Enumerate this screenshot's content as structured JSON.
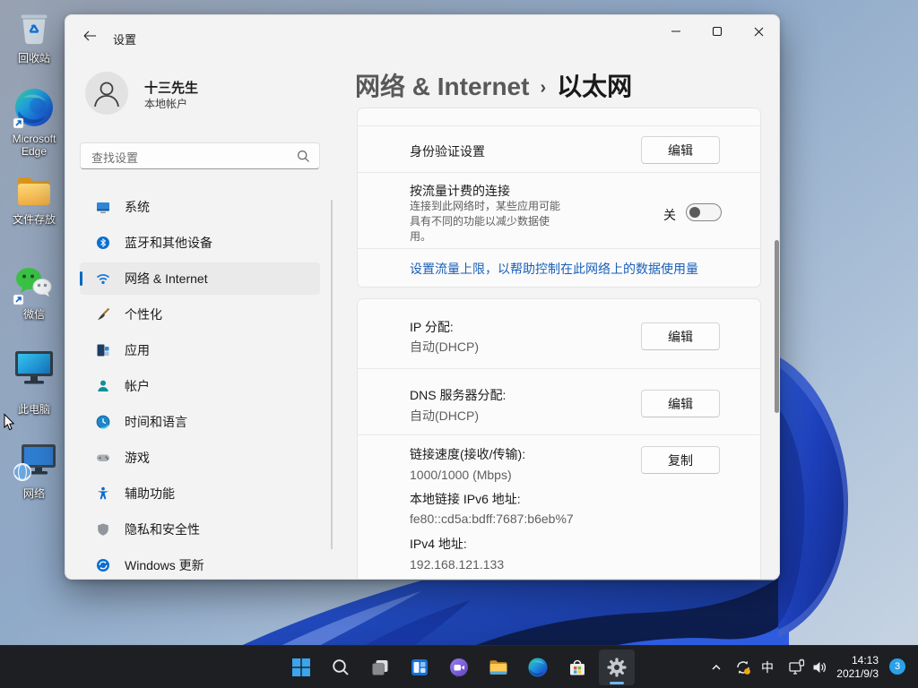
{
  "desktop": {
    "icons": [
      {
        "label": "回收站"
      },
      {
        "label": "Microsoft Edge"
      },
      {
        "label": "文件存放"
      },
      {
        "label": "微信"
      },
      {
        "label": "此电脑"
      },
      {
        "label": "网络"
      }
    ]
  },
  "window": {
    "title": "设置",
    "user": {
      "name": "十三先生",
      "type": "本地帐户"
    },
    "search_placeholder": "查找设置",
    "nav": [
      {
        "label": "系统"
      },
      {
        "label": "蓝牙和其他设备"
      },
      {
        "label": "网络 & Internet"
      },
      {
        "label": "个性化"
      },
      {
        "label": "应用"
      },
      {
        "label": "帐户"
      },
      {
        "label": "时间和语言"
      },
      {
        "label": "游戏"
      },
      {
        "label": "辅助功能"
      },
      {
        "label": "隐私和安全性"
      },
      {
        "label": "Windows 更新"
      }
    ],
    "breadcrumb": {
      "root": "网络 & Internet",
      "sep": "›",
      "current": "以太网"
    },
    "content": {
      "auth": {
        "label": "身份验证设置",
        "button": "编辑"
      },
      "metered": {
        "title": "按流量计费的连接",
        "desc": "连接到此网络时，某些应用可能具有不同的功能以减少数据使用。",
        "state": "关"
      },
      "data_limit_link": "设置流量上限，以帮助控制在此网络上的数据使用量",
      "ip": {
        "label": "IP 分配:",
        "value": "自动(DHCP)",
        "button": "编辑"
      },
      "dns": {
        "label": "DNS 服务器分配:",
        "value": "自动(DHCP)",
        "button": "编辑"
      },
      "speed": {
        "label": "链接速度(接收/传输):",
        "value": "1000/1000 (Mbps)",
        "ipv6_label": "本地链接 IPv6 地址:",
        "ipv6": "fe80::cd5a:bdff:7687:b6eb%7",
        "ipv4_label": "IPv4 地址:",
        "ipv4": "192.168.121.133",
        "button": "复制"
      }
    }
  },
  "taskbar": {
    "tray": {
      "ime": "中",
      "time": "14:13",
      "date": "2021/9/3",
      "badge": "3"
    }
  },
  "colors": {
    "accent": "#0067c0",
    "link": "#1a5fb8",
    "taskbar": "#1d1f23"
  }
}
